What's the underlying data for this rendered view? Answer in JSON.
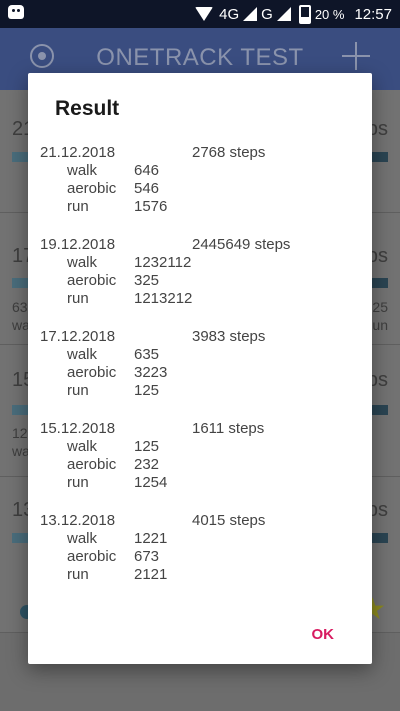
{
  "status_bar": {
    "network": "4G",
    "network2": "G",
    "battery": "20 %",
    "time": "12:57"
  },
  "app_bar": {
    "title": "ONETRACK TEST"
  },
  "background": {
    "cards": [
      {
        "date": "21",
        "right": "ps"
      },
      {
        "date": "17",
        "right": "ps",
        "sub_left": "63",
        "sub_left2": "wa",
        "sub_right": "25",
        "sub_right2": "un"
      },
      {
        "date": "15",
        "right": "ps",
        "sub_left": "12",
        "sub_left2": "wa"
      },
      {
        "date": "13",
        "right": "ps"
      }
    ]
  },
  "dialog": {
    "title": "Result",
    "ok_label": "OK",
    "entries": [
      {
        "date": "21.12.2018",
        "steps": "2768 steps",
        "walk_label": "walk",
        "walk": "646",
        "aerobic_label": "aerobic",
        "aerobic": "546",
        "run_label": "run",
        "run": "1576"
      },
      {
        "date": "19.12.2018",
        "steps": "2445649 steps",
        "walk_label": "walk",
        "walk": "1232112",
        "aerobic_label": "aerobic",
        "aerobic": "325",
        "run_label": "run",
        "run": "1213212"
      },
      {
        "date": "17.12.2018",
        "steps": "3983 steps",
        "walk_label": "walk",
        "walk": "635",
        "aerobic_label": "aerobic",
        "aerobic": "3223",
        "run_label": "run",
        "run": "125"
      },
      {
        "date": "15.12.2018",
        "steps": "1611 steps",
        "walk_label": "walk",
        "walk": "125",
        "aerobic_label": "aerobic",
        "aerobic": "232",
        "run_label": "run",
        "run": "1254"
      },
      {
        "date": "13.12.2018",
        "steps": "4015 steps",
        "walk_label": "walk",
        "walk": "1221",
        "aerobic_label": "aerobic",
        "aerobic": "673",
        "run_label": "run",
        "run": "2121"
      }
    ]
  }
}
